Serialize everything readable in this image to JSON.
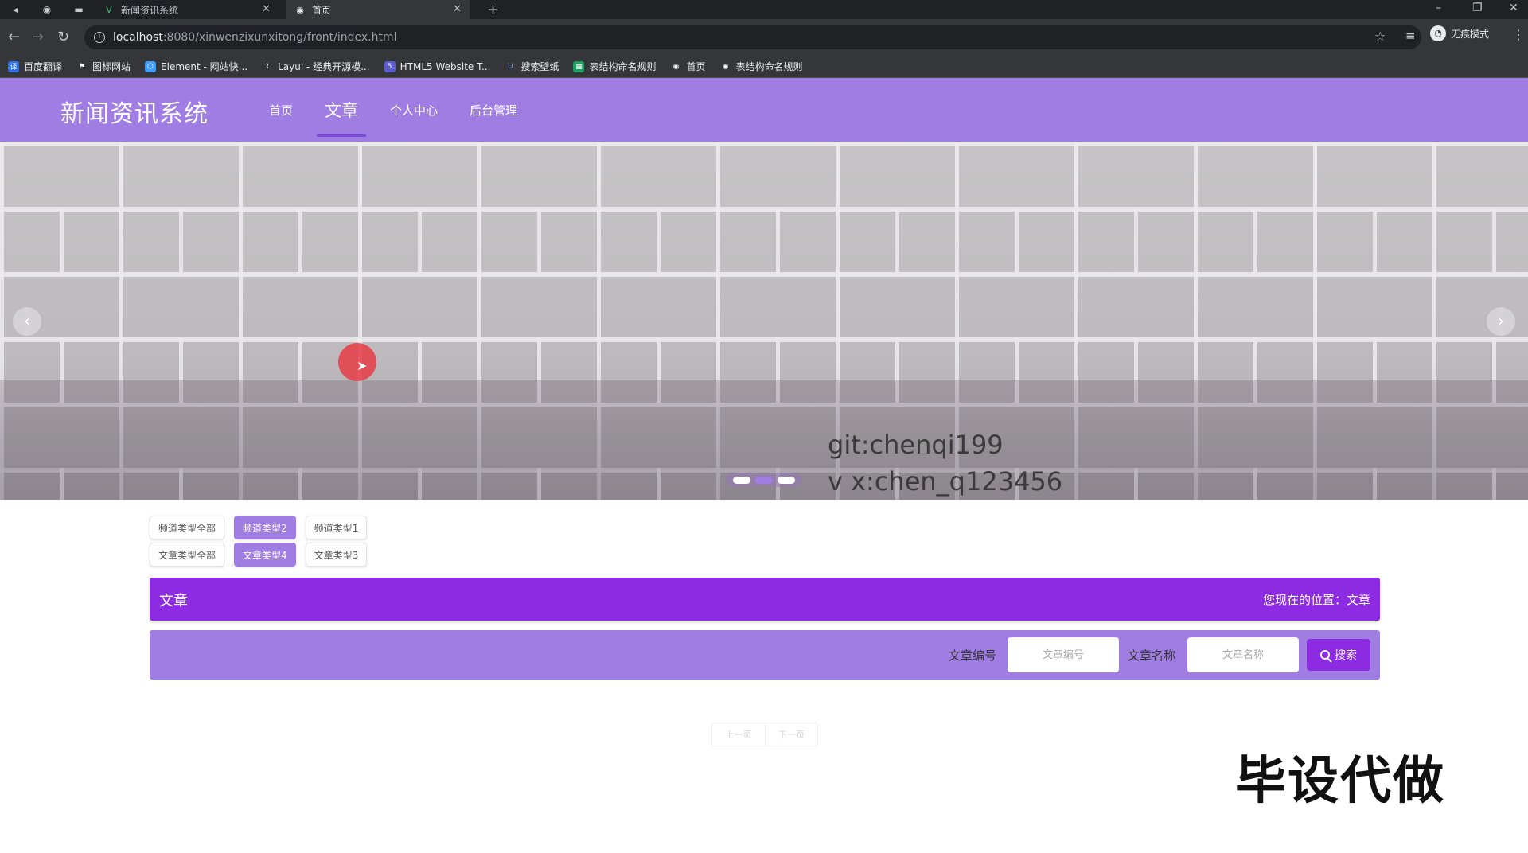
{
  "browser": {
    "tabs": [
      {
        "title": "新闻资讯系统",
        "active": false
      },
      {
        "title": "首页",
        "active": true
      }
    ],
    "url_host": "localhost",
    "url_path": ":8080/xinwenzixunxitong/front/index.html",
    "profile_label": "无痕模式",
    "bookmarks": [
      {
        "label": "百度翻译",
        "color": "#2a6ee8"
      },
      {
        "label": "图标网站",
        "color": "#444444"
      },
      {
        "label": "Element - 网站快...",
        "color": "#409eff"
      },
      {
        "label": "Layui - 经典开源模...",
        "color": "#444444"
      },
      {
        "label": "HTML5 Website T...",
        "color": "#5b5bd6"
      },
      {
        "label": "搜索壁纸",
        "color": "#3a6fd8"
      },
      {
        "label": "表结构命名规则",
        "color": "#1aa260"
      },
      {
        "label": "首页",
        "color": "#444444"
      },
      {
        "label": "表结构命名规则",
        "color": "#444444"
      }
    ]
  },
  "site": {
    "title": "新闻资讯系统",
    "nav": [
      {
        "label": "首页",
        "active": false
      },
      {
        "label": "文章",
        "active": true
      },
      {
        "label": "个人中心",
        "active": false
      },
      {
        "label": "后台管理",
        "active": false
      }
    ]
  },
  "banner": {
    "text_line1": "git:chenqi199",
    "text_line2": "v x:chen_q123456",
    "slide_count": 3,
    "active_slide": 2
  },
  "filters": {
    "channel": [
      "频道类型全部",
      "频道类型2",
      "频道类型1"
    ],
    "channel_active": 1,
    "article": [
      "文章类型全部",
      "文章类型4",
      "文章类型3"
    ],
    "article_active": 1
  },
  "section": {
    "title": "文章",
    "location": "您现在的位置：文章"
  },
  "search": {
    "id_label": "文章编号",
    "id_placeholder": "文章编号",
    "name_label": "文章名称",
    "name_placeholder": "文章名称",
    "button_label": "搜索"
  },
  "pager": {
    "prev_label": "上一页",
    "next_label": "下一页"
  },
  "overlay_caption": "毕设代做",
  "colors": {
    "header": "#a07de3",
    "accent": "#8c2be2"
  }
}
